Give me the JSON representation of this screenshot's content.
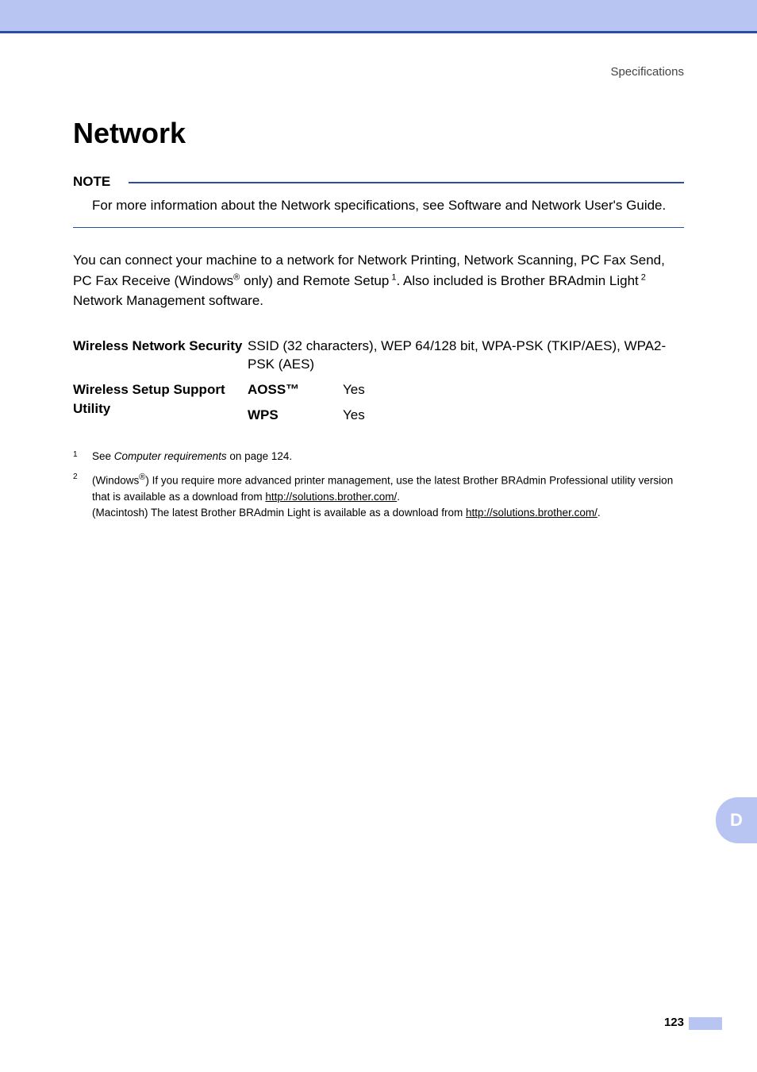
{
  "header": {
    "section": "Specifications"
  },
  "title": "Network",
  "note": {
    "label": "NOTE",
    "text": "For more information about the Network specifications, see Software and Network User's Guide."
  },
  "intro": {
    "part1": "You can connect your machine to a network for Network Printing, Network Scanning, PC Fax Send, PC Fax Receive (Windows",
    "reg1": "®",
    "part2": " only) and Remote Setup",
    "sup1": " 1",
    "part3": ". Also included is Brother BRAdmin Light",
    "sup2": " 2",
    "part4": " Network Management software."
  },
  "specs": {
    "row1": {
      "label": "Wireless Network Security",
      "value": "SSID (32 characters), WEP 64/128 bit, WPA-PSK (TKIP/AES), WPA2-PSK (AES)"
    },
    "row2": {
      "label": "Wireless Setup Support Utility",
      "sub1_label": "AOSS™",
      "sub1_value": "Yes",
      "sub2_label": "WPS",
      "sub2_value": "Yes"
    }
  },
  "footnotes": {
    "fn1": {
      "num": "1",
      "prefix": "See ",
      "italic": "Computer requirements",
      "suffix": " on page 124."
    },
    "fn2": {
      "num": "2",
      "part1": "(Windows",
      "reg": "®",
      "part2": ") If you require more advanced printer management, use the latest Brother BRAdmin Professional utility version that is available as a download from ",
      "link1": "http://solutions.brother.com/",
      "part3": ".",
      "part4": "(Macintosh) The latest Brother BRAdmin Light is available as a download from ",
      "link2": "http://solutions.brother.com/",
      "part5": "."
    }
  },
  "sideTab": "D",
  "pageNumber": "123"
}
